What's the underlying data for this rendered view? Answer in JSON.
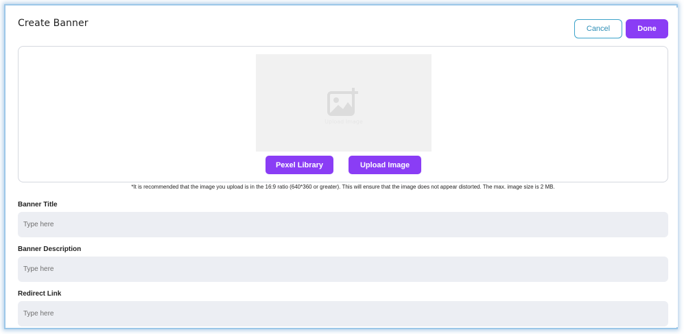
{
  "dialog": {
    "title": "Create Banner",
    "cancel_label": "Cancel",
    "done_label": "Done"
  },
  "uploader": {
    "preview_label": "Upload Image",
    "pexel_label": "Pexel Library",
    "upload_label": "Upload Image",
    "note": "*It is recommended that the image you upload is in the 16:9 ratio (640*360 or greater). This will ensure that the image does not appear distorted. The max. image size is 2 MB."
  },
  "fields": {
    "title": {
      "label": "Banner Title",
      "placeholder": "Type here",
      "value": ""
    },
    "description": {
      "label": "Banner Description",
      "placeholder": "Type here",
      "value": ""
    },
    "redirect": {
      "label": "Redirect Link",
      "placeholder": "Type here",
      "value": ""
    }
  },
  "colors": {
    "accent": "#8a3df5",
    "cancel_border": "#3aa2c9",
    "field_bg": "#eceef3"
  },
  "icons": {
    "preview": "add-image-icon"
  }
}
